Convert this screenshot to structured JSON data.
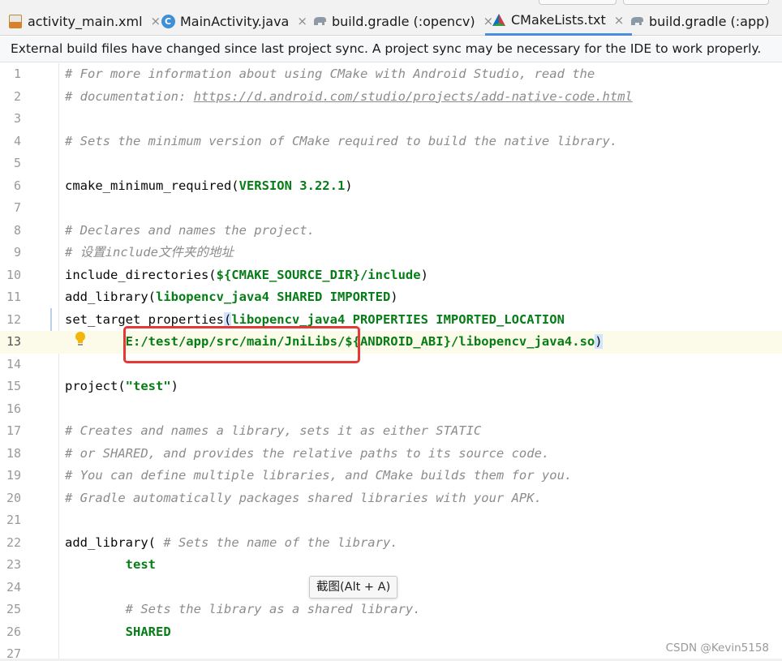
{
  "tabs": [
    {
      "label": "activity_main.xml",
      "icon": "xml-file-icon",
      "close": "×"
    },
    {
      "label": "MainActivity.java",
      "icon": "java-class-icon",
      "close": "×"
    },
    {
      "label": "build.gradle (:opencv)",
      "icon": "gradle-elephant-icon",
      "close": "×"
    },
    {
      "label": "CMakeLists.txt",
      "icon": "cmake-icon",
      "close": "×",
      "active": true
    },
    {
      "label": "build.gradle (:app)",
      "icon": "gradle-elephant-icon",
      "close": "×"
    }
  ],
  "notification": "External build files have changed since last project sync. A project sync may be necessary for the IDE to work properly.",
  "editor": {
    "current_line": 13,
    "line_numbers": [
      "1",
      "2",
      "3",
      "4",
      "5",
      "6",
      "7",
      "8",
      "9",
      "10",
      "11",
      "12",
      "13",
      "14",
      "15",
      "16",
      "17",
      "18",
      "19",
      "20",
      "21",
      "22",
      "23",
      "24",
      "25",
      "26",
      "27"
    ],
    "lines": {
      "l1": "# For more information about using CMake with Android Studio, read the",
      "l2_prefix": "# documentation: ",
      "l2_link": "https://d.android.com/studio/projects/add-native-code.html",
      "l4": "# Sets the minimum version of CMake required to build the native library.",
      "l6_a": "cmake_minimum_required(",
      "l6_b": "VERSION 3.22.1",
      "l6_c": ")",
      "l8": "# Declares and names the project.",
      "l9": "# 设置include文件夹的地址",
      "l10_a": "include_directories(",
      "l10_b": "${CMAKE_SOURCE_DIR}/include",
      "l10_c": ")",
      "l11_a": "add_library(",
      "l11_b": "libopencv_java4 SHARED IMPORTED",
      "l11_c": ")",
      "l12_a": "set_target_properties",
      "l12_b": "(",
      "l12_c": "libopencv_java4 PROPERTIES IMPORTED_LOCATION",
      "l13_indent": "        ",
      "l13_a": "E:/test/app/src/main/JniLibs/${ANDROID_ABI}/libopencv_java4.so",
      "l13_b": ")",
      "l15_a": "project(",
      "l15_b": "\"test\"",
      "l15_c": ")",
      "l17": "# Creates and names a library, sets it as either STATIC",
      "l18": "# or SHARED, and provides the relative paths to its source code.",
      "l19": "# You can define multiple libraries, and CMake builds them for you.",
      "l20": "# Gradle automatically packages shared libraries with your APK.",
      "l22_a": "add_library( ",
      "l22_b": "# Sets the name of the library.",
      "l23": "        test",
      "l25": "        # Sets the library as a shared library.",
      "l26": "        SHARED"
    }
  },
  "tooltip": "截图(Alt + A)",
  "watermark": "CSDN @Kevin5158",
  "colors": {
    "comment": "#8c8c8c",
    "keyword_green": "#067d17",
    "highlight_box": "#e53935",
    "active_tab": "#4a8de0",
    "current_line": "#fcfae8"
  }
}
